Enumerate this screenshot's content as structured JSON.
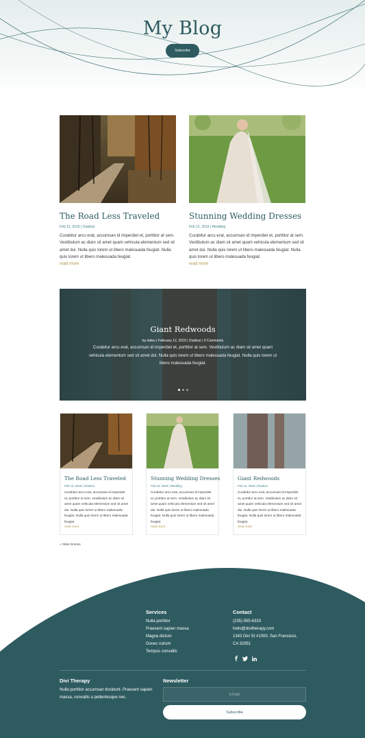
{
  "header": {
    "title": "My Blog",
    "subscribe_label": "Subscribe"
  },
  "featured_posts": [
    {
      "title": "The Road Less Traveled",
      "meta": "Feb 12, 2019 | Outdoor",
      "excerpt": "Curabitur arcu erat, accumsan id imperdiet et, porttitor at sem. Vestibulum ac diam sit amet quam vehicula elementum sed sit amet dui. Nulla quis lorem ut libero malesuada feugiat. Nulla quis lorem ut libero malesuada feugiat.",
      "read_more": "read more"
    },
    {
      "title": "Stunning Wedding Dresses",
      "meta": "Feb 12, 2019 | Wedding",
      "excerpt": "Curabitur arcu erat, accumsan id imperdiet et, porttitor at sem. Vestibulum ac diam sit amet quam vehicula elementum sed sit amet dui. Nulla quis lorem ut libero malesuada feugiat. Nulla quis lorem ut libero malesuada feugiat.",
      "read_more": "read more"
    }
  ],
  "slider": {
    "title": "Giant Redwoods",
    "meta": "by etdev | February 12, 2019 | Outdoor | 0 Comments",
    "excerpt": "Curabitur arcu erat, accumsan id imperdiet et, porttitor at sem. Vestibulum ac diam sit amet quam vehicula elementum sed sit amet dui. Nulla quis lorem ut libero malesuada feugiat. Nulla quis lorem ut libero malesuada feugiat.",
    "slide_count": 3,
    "active_slide": 1
  },
  "cards": [
    {
      "title": "The Road Less Traveled",
      "meta": "Feb 12, 2019 | Outdoor",
      "excerpt": "Curabitur arcu erat, accumsan id imperdiet et, porttitor at sem. Vestibulum ac diam sit amet quam vehicula elementum sed sit amet dui. Nulla quis lorem ut libero malesuada feugiat. Nulla quis lorem ut libero malesuada feugiat.",
      "read_more": "read more"
    },
    {
      "title": "Stunning Wedding Dresses",
      "meta": "Feb 12, 2019 | Wedding",
      "excerpt": "Curabitur arcu erat, accumsan id imperdiet et, porttitor at sem. Vestibulum ac diam sit amet quam vehicula elementum sed sit amet dui. Nulla quis lorem ut libero malesuada feugiat. Nulla quis lorem ut libero malesuada feugiat.",
      "read_more": "read more"
    },
    {
      "title": "Giant Redwoods",
      "meta": "Feb 12, 2019 | Outdoor",
      "excerpt": "Curabitur arcu erat, accumsan id imperdiet et, porttitor at sem. Vestibulum ac diam sit amet quam vehicula elementum sed sit amet dui. Nulla quis lorem ut libero malesuada feugiat. Nulla quis lorem ut libero malesuada feugiat.",
      "read_more": "read more"
    }
  ],
  "pagination": {
    "older_label": "« Older Entries"
  },
  "footer": {
    "services": {
      "heading": "Services",
      "items": [
        "Nulla porttitor",
        "Praesent sapien massa",
        "Magna dictum",
        "Donec rutrum",
        "Tempus convallis"
      ]
    },
    "contact": {
      "heading": "Contact",
      "lines": [
        "(235) 955-6333",
        "hello@divitherapy.com",
        "1343 Divi St #1000, San Francisco,",
        "CA 32951"
      ]
    },
    "social": {
      "icons": [
        "facebook-icon",
        "twitter-icon",
        "linkedin-icon"
      ],
      "glyphs": [
        "f",
        "t",
        "in"
      ]
    },
    "about": {
      "heading": "Divi Therapy",
      "text": "Nulla porttitor accumsan tincidunt. Praesent sapien massa, convallis a pellentesque nec."
    },
    "newsletter": {
      "heading": "Newsletter",
      "email_placeholder": "Email",
      "email_value": "",
      "subscribe_label": "Subscribe"
    }
  },
  "colors": {
    "brand_teal": "#2e5b60",
    "heading_teal": "#2c5a5e",
    "link_gold": "#b09445",
    "meta_teal": "#3f7f86"
  }
}
